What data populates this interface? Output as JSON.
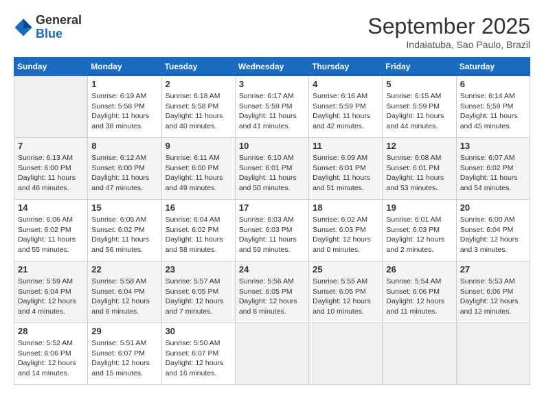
{
  "header": {
    "logo_line1": "General",
    "logo_line2": "Blue",
    "month": "September 2025",
    "location": "Indaiatuba, Sao Paulo, Brazil"
  },
  "weekdays": [
    "Sunday",
    "Monday",
    "Tuesday",
    "Wednesday",
    "Thursday",
    "Friday",
    "Saturday"
  ],
  "weeks": [
    [
      {
        "day": "",
        "info": ""
      },
      {
        "day": "1",
        "info": "Sunrise: 6:19 AM\nSunset: 5:58 PM\nDaylight: 11 hours\nand 38 minutes."
      },
      {
        "day": "2",
        "info": "Sunrise: 6:18 AM\nSunset: 5:58 PM\nDaylight: 11 hours\nand 40 minutes."
      },
      {
        "day": "3",
        "info": "Sunrise: 6:17 AM\nSunset: 5:59 PM\nDaylight: 11 hours\nand 41 minutes."
      },
      {
        "day": "4",
        "info": "Sunrise: 6:16 AM\nSunset: 5:59 PM\nDaylight: 11 hours\nand 42 minutes."
      },
      {
        "day": "5",
        "info": "Sunrise: 6:15 AM\nSunset: 5:59 PM\nDaylight: 11 hours\nand 44 minutes."
      },
      {
        "day": "6",
        "info": "Sunrise: 6:14 AM\nSunset: 5:59 PM\nDaylight: 11 hours\nand 45 minutes."
      }
    ],
    [
      {
        "day": "7",
        "info": "Sunrise: 6:13 AM\nSunset: 6:00 PM\nDaylight: 11 hours\nand 46 minutes."
      },
      {
        "day": "8",
        "info": "Sunrise: 6:12 AM\nSunset: 6:00 PM\nDaylight: 11 hours\nand 47 minutes."
      },
      {
        "day": "9",
        "info": "Sunrise: 6:11 AM\nSunset: 6:00 PM\nDaylight: 11 hours\nand 49 minutes."
      },
      {
        "day": "10",
        "info": "Sunrise: 6:10 AM\nSunset: 6:01 PM\nDaylight: 11 hours\nand 50 minutes."
      },
      {
        "day": "11",
        "info": "Sunrise: 6:09 AM\nSunset: 6:01 PM\nDaylight: 11 hours\nand 51 minutes."
      },
      {
        "day": "12",
        "info": "Sunrise: 6:08 AM\nSunset: 6:01 PM\nDaylight: 11 hours\nand 53 minutes."
      },
      {
        "day": "13",
        "info": "Sunrise: 6:07 AM\nSunset: 6:02 PM\nDaylight: 11 hours\nand 54 minutes."
      }
    ],
    [
      {
        "day": "14",
        "info": "Sunrise: 6:06 AM\nSunset: 6:02 PM\nDaylight: 11 hours\nand 55 minutes."
      },
      {
        "day": "15",
        "info": "Sunrise: 6:05 AM\nSunset: 6:02 PM\nDaylight: 11 hours\nand 56 minutes."
      },
      {
        "day": "16",
        "info": "Sunrise: 6:04 AM\nSunset: 6:02 PM\nDaylight: 11 hours\nand 58 minutes."
      },
      {
        "day": "17",
        "info": "Sunrise: 6:03 AM\nSunset: 6:03 PM\nDaylight: 11 hours\nand 59 minutes."
      },
      {
        "day": "18",
        "info": "Sunrise: 6:02 AM\nSunset: 6:03 PM\nDaylight: 12 hours\nand 0 minutes."
      },
      {
        "day": "19",
        "info": "Sunrise: 6:01 AM\nSunset: 6:03 PM\nDaylight: 12 hours\nand 2 minutes."
      },
      {
        "day": "20",
        "info": "Sunrise: 6:00 AM\nSunset: 6:04 PM\nDaylight: 12 hours\nand 3 minutes."
      }
    ],
    [
      {
        "day": "21",
        "info": "Sunrise: 5:59 AM\nSunset: 6:04 PM\nDaylight: 12 hours\nand 4 minutes."
      },
      {
        "day": "22",
        "info": "Sunrise: 5:58 AM\nSunset: 6:04 PM\nDaylight: 12 hours\nand 6 minutes."
      },
      {
        "day": "23",
        "info": "Sunrise: 5:57 AM\nSunset: 6:05 PM\nDaylight: 12 hours\nand 7 minutes."
      },
      {
        "day": "24",
        "info": "Sunrise: 5:56 AM\nSunset: 6:05 PM\nDaylight: 12 hours\nand 8 minutes."
      },
      {
        "day": "25",
        "info": "Sunrise: 5:55 AM\nSunset: 6:05 PM\nDaylight: 12 hours\nand 10 minutes."
      },
      {
        "day": "26",
        "info": "Sunrise: 5:54 AM\nSunset: 6:06 PM\nDaylight: 12 hours\nand 11 minutes."
      },
      {
        "day": "27",
        "info": "Sunrise: 5:53 AM\nSunset: 6:06 PM\nDaylight: 12 hours\nand 12 minutes."
      }
    ],
    [
      {
        "day": "28",
        "info": "Sunrise: 5:52 AM\nSunset: 6:06 PM\nDaylight: 12 hours\nand 14 minutes."
      },
      {
        "day": "29",
        "info": "Sunrise: 5:51 AM\nSunset: 6:07 PM\nDaylight: 12 hours\nand 15 minutes."
      },
      {
        "day": "30",
        "info": "Sunrise: 5:50 AM\nSunset: 6:07 PM\nDaylight: 12 hours\nand 16 minutes."
      },
      {
        "day": "",
        "info": ""
      },
      {
        "day": "",
        "info": ""
      },
      {
        "day": "",
        "info": ""
      },
      {
        "day": "",
        "info": ""
      }
    ]
  ]
}
